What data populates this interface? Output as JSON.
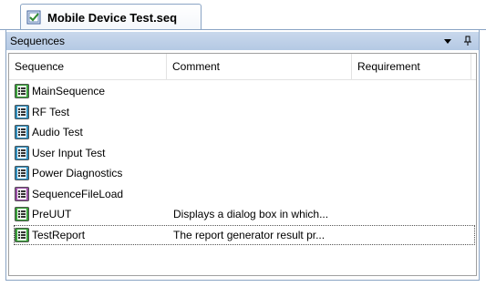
{
  "document_tab": {
    "title": "Mobile Device Test.seq",
    "icon": "sequence-file-icon"
  },
  "panel": {
    "title": "Sequences",
    "buttons": [
      "dropdown-arrow-icon",
      "pin-icon"
    ]
  },
  "columns": [
    "Sequence",
    "Comment",
    "Requirement"
  ],
  "sequences": [
    {
      "name": "MainSequence",
      "comment": "",
      "icon": "sequence-icon",
      "color": "#3aa23a"
    },
    {
      "name": "RF Test",
      "comment": "",
      "icon": "sequence-icon",
      "color": "#2f8fbf"
    },
    {
      "name": "Audio Test",
      "comment": "",
      "icon": "sequence-icon",
      "color": "#2f8fbf"
    },
    {
      "name": "User Input Test",
      "comment": "",
      "icon": "sequence-icon",
      "color": "#2f8fbf"
    },
    {
      "name": "Power Diagnostics",
      "comment": "",
      "icon": "sequence-icon",
      "color": "#2f8fbf"
    },
    {
      "name": "SequenceFileLoad",
      "comment": "",
      "icon": "callback-sequence-icon",
      "color": "#9a4fa6"
    },
    {
      "name": "PreUUT",
      "comment": "Displays a dialog box in which...",
      "icon": "callback-sequence-icon",
      "color": "#3aa23a"
    },
    {
      "name": "TestReport",
      "comment": "The report generator result pr...",
      "icon": "callback-sequence-icon",
      "color": "#3aa23a",
      "selected": true
    }
  ]
}
